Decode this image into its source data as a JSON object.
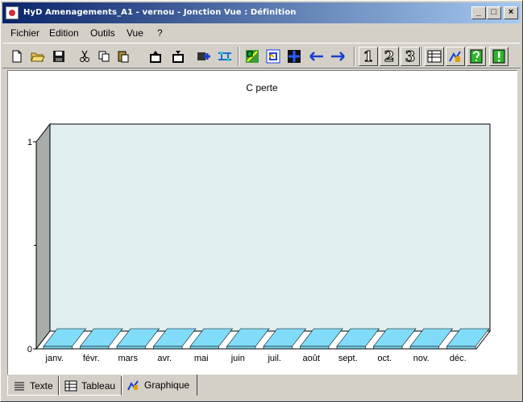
{
  "window": {
    "title": "HyD Amenagements_A1 - vernou - Jonction Vue  : Définition",
    "minimize_glyph": "_",
    "maximize_glyph": "□",
    "close_glyph": "×"
  },
  "menu": {
    "items": [
      "Fichier",
      "Edition",
      "Outils",
      "Vue",
      "?"
    ]
  },
  "toolbar": {
    "numbered_buttons": [
      "1",
      "2",
      "3"
    ]
  },
  "chart_data": {
    "type": "bar",
    "title": "C perte",
    "categories": [
      "janv.",
      "févr.",
      "mars",
      "avr.",
      "mai",
      "juin",
      "juil.",
      "août",
      "sept.",
      "oct.",
      "nov.",
      "déc."
    ],
    "values": [
      0,
      0,
      0,
      0,
      0,
      0,
      0,
      0,
      0,
      0,
      0,
      0
    ],
    "ylim": [
      0,
      1
    ],
    "y_ticks": [
      "0",
      "1"
    ],
    "xlabel": "",
    "ylabel": "",
    "three_d": true,
    "colors": {
      "plot_back": "#e1eff0",
      "plot_side": "#a9adaa",
      "bar_fill": "#80dcf8",
      "floor": "#ffffff"
    }
  },
  "tabs": [
    {
      "label": "Texte",
      "active": false
    },
    {
      "label": "Tableau",
      "active": false
    },
    {
      "label": "Graphique",
      "active": true
    }
  ]
}
